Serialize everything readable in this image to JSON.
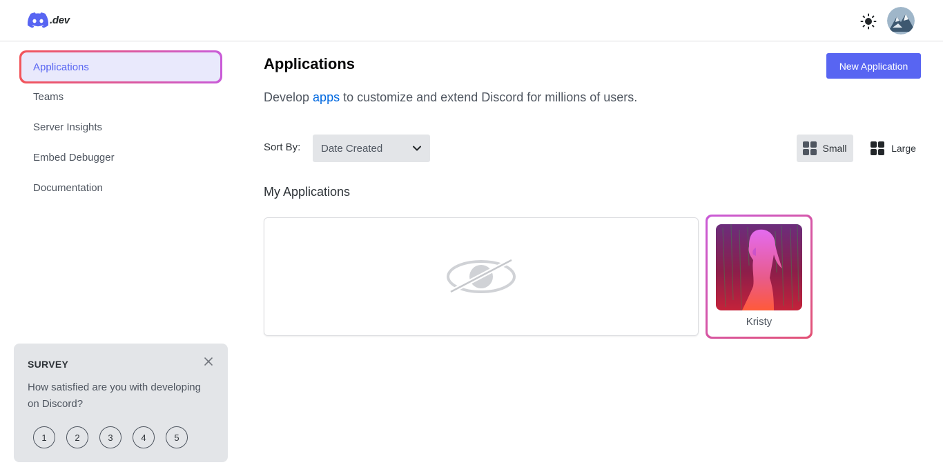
{
  "header": {
    "logo_text": ".dev",
    "theme_toggle_icon": "sun-icon",
    "avatar_icon": "user-avatar"
  },
  "sidebar": {
    "items": [
      {
        "label": "Applications",
        "active": true
      },
      {
        "label": "Teams",
        "active": false
      },
      {
        "label": "Server Insights",
        "active": false
      },
      {
        "label": "Embed Debugger",
        "active": false
      },
      {
        "label": "Documentation",
        "active": false
      }
    ]
  },
  "survey": {
    "title": "SURVEY",
    "question": "How satisfied are you with developing on Discord?",
    "ratings": [
      "1",
      "2",
      "3",
      "4",
      "5"
    ]
  },
  "main": {
    "title": "Applications",
    "new_button": "New Application",
    "subtitle_before": "Develop ",
    "subtitle_link": "apps",
    "subtitle_after": " to customize and extend Discord for millions of users.",
    "sort_label": "Sort By:",
    "sort_value": "Date Created",
    "view_small": "Small",
    "view_large": "Large",
    "section_title": "My Applications",
    "apps": [
      {
        "name": "Kristy"
      }
    ]
  },
  "colors": {
    "accent": "#5865f2",
    "link": "#0068e0",
    "highlight_start": "#f2555a",
    "highlight_end": "#c95bd8"
  }
}
